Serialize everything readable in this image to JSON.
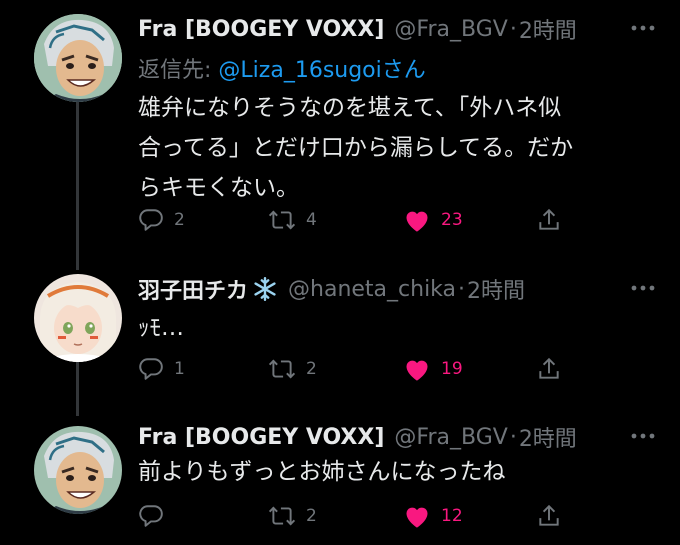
{
  "tweets": [
    {
      "name": "Fra [BOOGEY VOXX]",
      "handle": "@Fra_BGV",
      "separator": "·",
      "time": "2時間",
      "reply_label": "返信先:",
      "reply_mention": "@Liza_16sugoi",
      "reply_suffix": "さん",
      "text": "雄弁になりそうなのを堪えて、「外ハネ似\n合ってる」とだけ口から漏らしてる。だか\nらキモくない。",
      "replies": "2",
      "retweets": "4",
      "likes": "23"
    },
    {
      "name": "羽子田チカ",
      "handle": "@haneta_chika",
      "separator": "·",
      "time": "2時間",
      "text": "ｯﾓ…",
      "replies": "1",
      "retweets": "2",
      "likes": "19"
    },
    {
      "name": "Fra [BOOGEY VOXX]",
      "handle": "@Fra_BGV",
      "separator": "·",
      "time": "2時間",
      "text": "前よりもずっとお姉さんになったね",
      "replies": "",
      "retweets": "2",
      "likes": "12"
    }
  ],
  "colors": {
    "background": "#000000",
    "text": "#e7e9ea",
    "secondary": "#71767b",
    "link": "#1d9bf0",
    "like": "#f91880",
    "thread_line": "#333639"
  },
  "icons": [
    "reply-icon",
    "retweet-icon",
    "like-icon",
    "share-icon",
    "more-icon",
    "snowflake-icon"
  ]
}
